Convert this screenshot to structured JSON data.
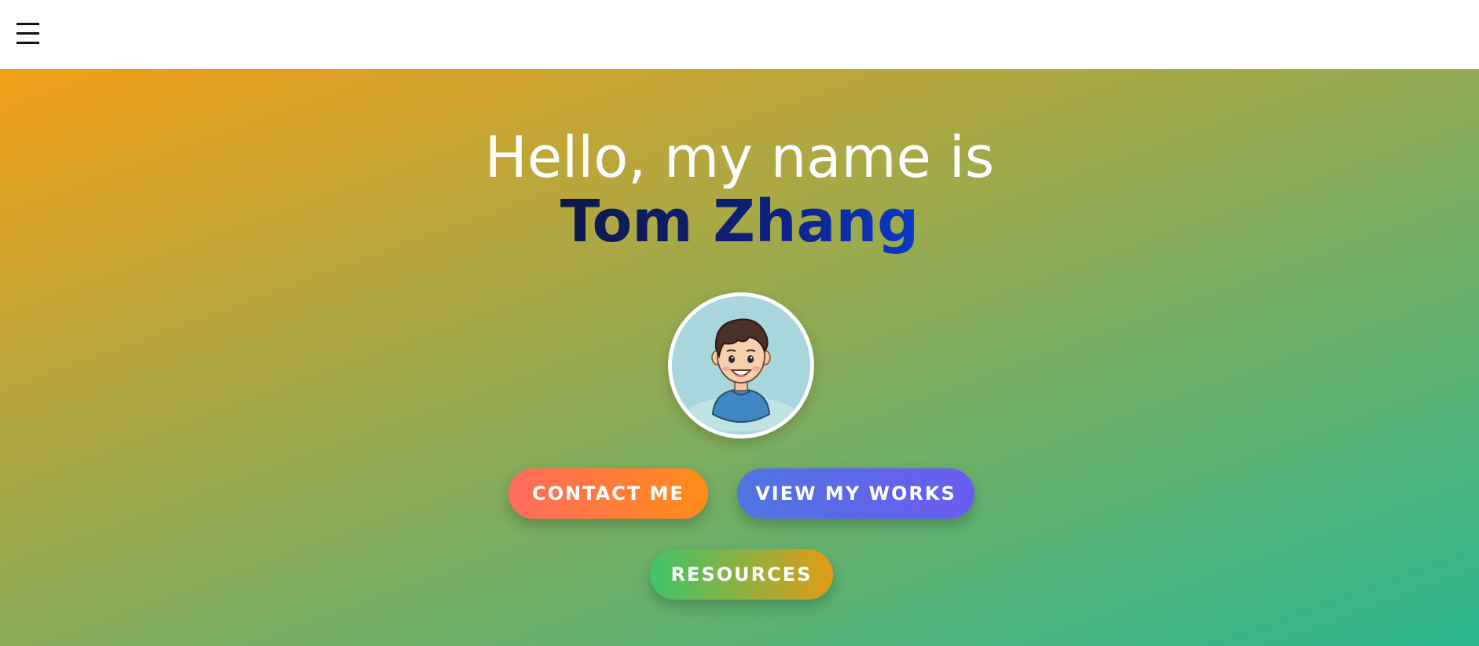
{
  "header": {
    "menu_icon": "hamburger-menu-icon"
  },
  "hero": {
    "greeting": "Hello, my name is",
    "name": "Tom Zhang",
    "avatar_icon": "cartoon-boy-avatar",
    "buttons": {
      "contact": "CONTACT ME",
      "works": "VIEW MY WORKS",
      "resources": "RESOURCES"
    }
  },
  "colors": {
    "gradient_start": "#f29e16",
    "gradient_end": "#2cb78f",
    "name_dark": "#0f1a48",
    "name_blue": "#0b39c9",
    "contact_button": "#ff7a3a",
    "works_button": "#5a6ae8",
    "resources_button": "#3ec46a"
  }
}
